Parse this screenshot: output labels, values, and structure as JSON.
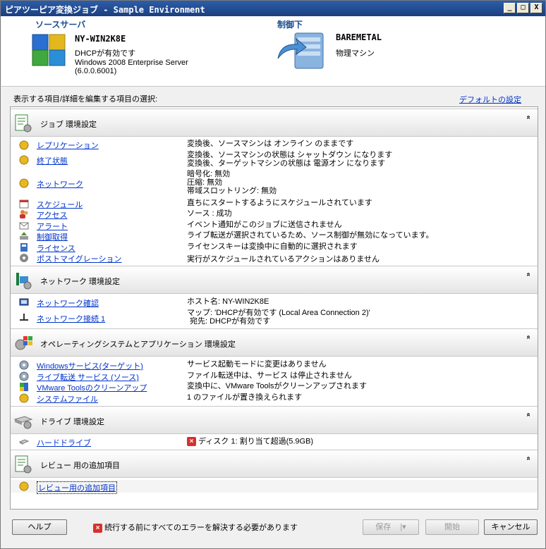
{
  "window": {
    "title": "ピアツーピア変換ジョブ - Sample Environment",
    "min_btn": "_",
    "max_btn": "□",
    "close_btn": "X"
  },
  "header": {
    "source_label": "ソースサーバ",
    "source_name": "NY-WIN2K8E",
    "source_line1": "DHCPが有効です",
    "source_line2": "Windows 2008 Enterprise Server",
    "source_line3": "(6.0.0.6001)",
    "target_label": "制御下",
    "target_name": "BAREMETAL",
    "target_line1": "物理マシン"
  },
  "select_label": "表示する項目/詳細を編集する項目の選択:",
  "default_link": "デフォルトの設定",
  "sections": {
    "job": {
      "title": "ジョブ 環境設定",
      "rows": [
        {
          "label": "レプリケーション",
          "value": "変換後、ソースマシンは オンライン のままです"
        },
        {
          "label": "終了状態",
          "value": "変換後、ソースマシンの状態は シャットダウン になります",
          "value2": "変換後、ターゲットマシンの状態は 電源オン になります"
        },
        {
          "label": "ネットワーク",
          "value": "暗号化: 無効",
          "value2": "圧縮: 無効",
          "value3": "帯域スロットリング: 無効"
        },
        {
          "label": "スケジュール",
          "value": "直ちにスタートするようにスケジュールされています"
        },
        {
          "label": "アクセス",
          "value": "ソース : 成功"
        },
        {
          "label": "アラート",
          "value": "イベント通知がこのジョブに送信されません"
        },
        {
          "label": "制御取得",
          "value": "ライブ転送が選択されているため、ソース制御が無効になっています。"
        },
        {
          "label": "ライセンス",
          "value": "ライセンスキーは変換中に自動的に選択されます"
        },
        {
          "label": "ポストマイグレーション",
          "value": "実行がスケジュールされているアクションはありません"
        }
      ]
    },
    "network": {
      "title": "ネットワーク 環境設定",
      "rows": [
        {
          "label": "ネットワーク確認",
          "value": "ホスト名: NY-WIN2K8E"
        },
        {
          "label": "ネットワーク接続 1",
          "value": "マップ: 'DHCPが有効です (Local Area Connection 2)'",
          "value2": "宛先: DHCPが有効です"
        }
      ]
    },
    "os": {
      "title": "オペレーティングシステムとアプリケーション 環境設定",
      "rows": [
        {
          "label": "Windowsサービス(ターゲット)",
          "value": "サービス起動モードに変更はありません"
        },
        {
          "label": "ライブ転送 サービス (ソース)",
          "value": "ファイル転送中は、サービス は停止されません"
        },
        {
          "label": "VMware Toolsのクリーンアップ",
          "value": "変換中に、VMware Toolsがクリーンアップされます"
        },
        {
          "label": "システムファイル",
          "value": "1 のファイルが置き換えられます"
        }
      ]
    },
    "drive": {
      "title": "ドライブ 環境設定",
      "rows": [
        {
          "label": "ハードドライブ",
          "value": "ディスク 1: 割り当て超過(5.9GB)"
        }
      ]
    },
    "review": {
      "title": "レビュー 用の追加項目",
      "rows": [
        {
          "label": "レビュー用の追加項目"
        }
      ]
    }
  },
  "chevron": "»",
  "footer": {
    "help": "ヘルプ",
    "error_msg": "続行する前にすべてのエラーを解決する必要があります",
    "save": "保存",
    "start": "開始",
    "cancel": "キャンセル"
  }
}
